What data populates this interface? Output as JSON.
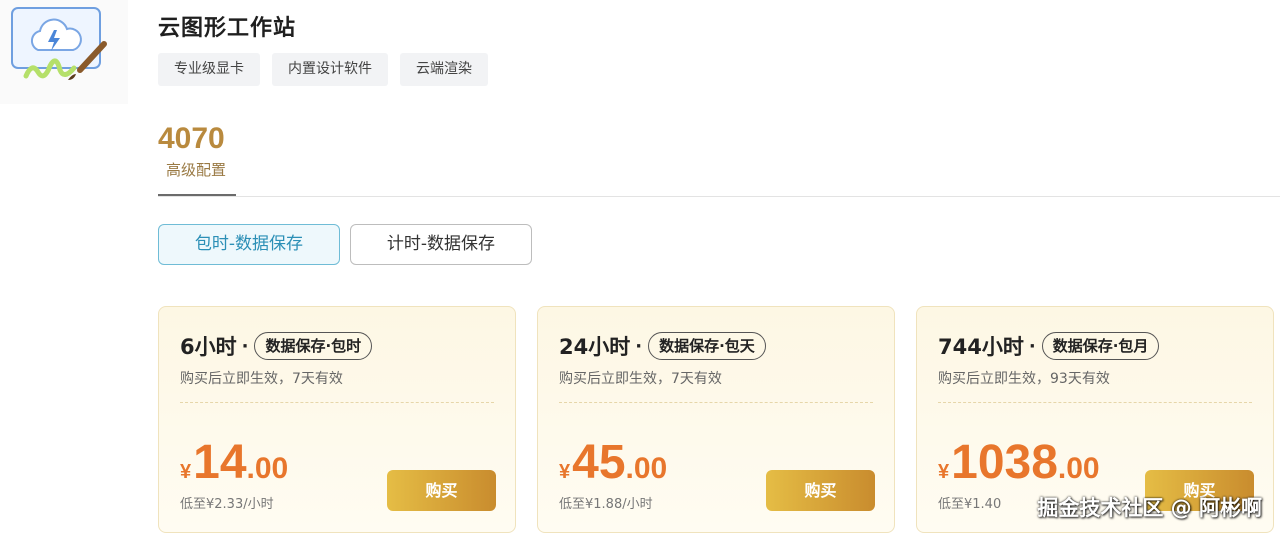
{
  "product": {
    "title": "云图形工作站",
    "tags": [
      "专业级显卡",
      "内置设计软件",
      "云端渲染"
    ]
  },
  "spec": {
    "number": "4070",
    "label": "高级配置"
  },
  "billing_modes": [
    {
      "label": "包时-数据保存",
      "selected": true
    },
    {
      "label": "计时-数据保存",
      "selected": false
    }
  ],
  "plans": [
    {
      "duration": "6小时",
      "badge": "数据保存·包时",
      "validity": "购买后立即生效，7天有效",
      "currency": "¥",
      "price_int": "14",
      "price_dec": ".00",
      "unit_price": "低至¥2.33/小时",
      "buy_label": "购买"
    },
    {
      "duration": "24小时",
      "badge": "数据保存·包天",
      "validity": "购买后立即生效，7天有效",
      "currency": "¥",
      "price_int": "45",
      "price_dec": ".00",
      "unit_price": "低至¥1.88/小时",
      "buy_label": "购买"
    },
    {
      "duration": "744小时",
      "badge": "数据保存·包月",
      "validity": "购买后立即生效，93天有效",
      "currency": "¥",
      "price_int": "1038",
      "price_dec": ".00",
      "unit_price": "低至¥1.40",
      "buy_label": "购买"
    }
  ],
  "separator_dot": "·",
  "watermark": "掘金技术社区 @ 阿彬啊",
  "colors": {
    "accent_price": "#e8762c",
    "accent_gold": "#c98c2e",
    "selected_mode": "#2b8fb6"
  }
}
